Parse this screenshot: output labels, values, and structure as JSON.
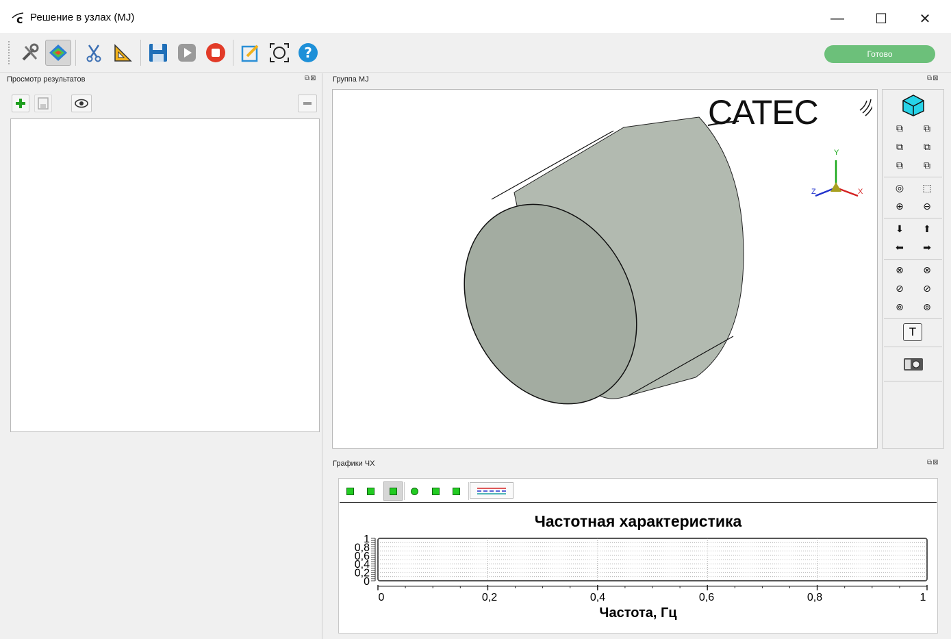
{
  "window": {
    "title": "Решение в узлах (MJ)",
    "controls": [
      "—",
      "☐",
      "✕"
    ]
  },
  "toolbar": {
    "icons": [
      "tools-icon",
      "results-map-icon",
      "cut-icon",
      "measure-icon",
      "save-icon",
      "play-icon",
      "stop-icon",
      "edit-icon",
      "target-icon",
      "help-icon"
    ],
    "status": "Готово",
    "status_color": "#6cc07a"
  },
  "left_panel": {
    "title": "Просмотр результатов"
  },
  "view_panel": {
    "title": "Группа MJ",
    "logo_text": "CATEC",
    "axes": {
      "x": "X",
      "y": "Y",
      "z": "Z"
    },
    "side_buttons": {
      "text_label": "T"
    }
  },
  "chart_panel": {
    "title": "Графики ЧХ"
  },
  "chart_data": {
    "type": "line",
    "title": "Частотная характеристика",
    "xlabel": "Частота, Гц",
    "ylabel": "",
    "xlim": [
      0,
      1
    ],
    "ylim": [
      0,
      1
    ],
    "x_ticks": [
      "0",
      "0,2",
      "0,4",
      "0,6",
      "0,8",
      "1"
    ],
    "y_ticks": [
      "0",
      "0,2",
      "0,4",
      "0,6",
      "0,8",
      "1"
    ],
    "grid": true,
    "series": []
  }
}
